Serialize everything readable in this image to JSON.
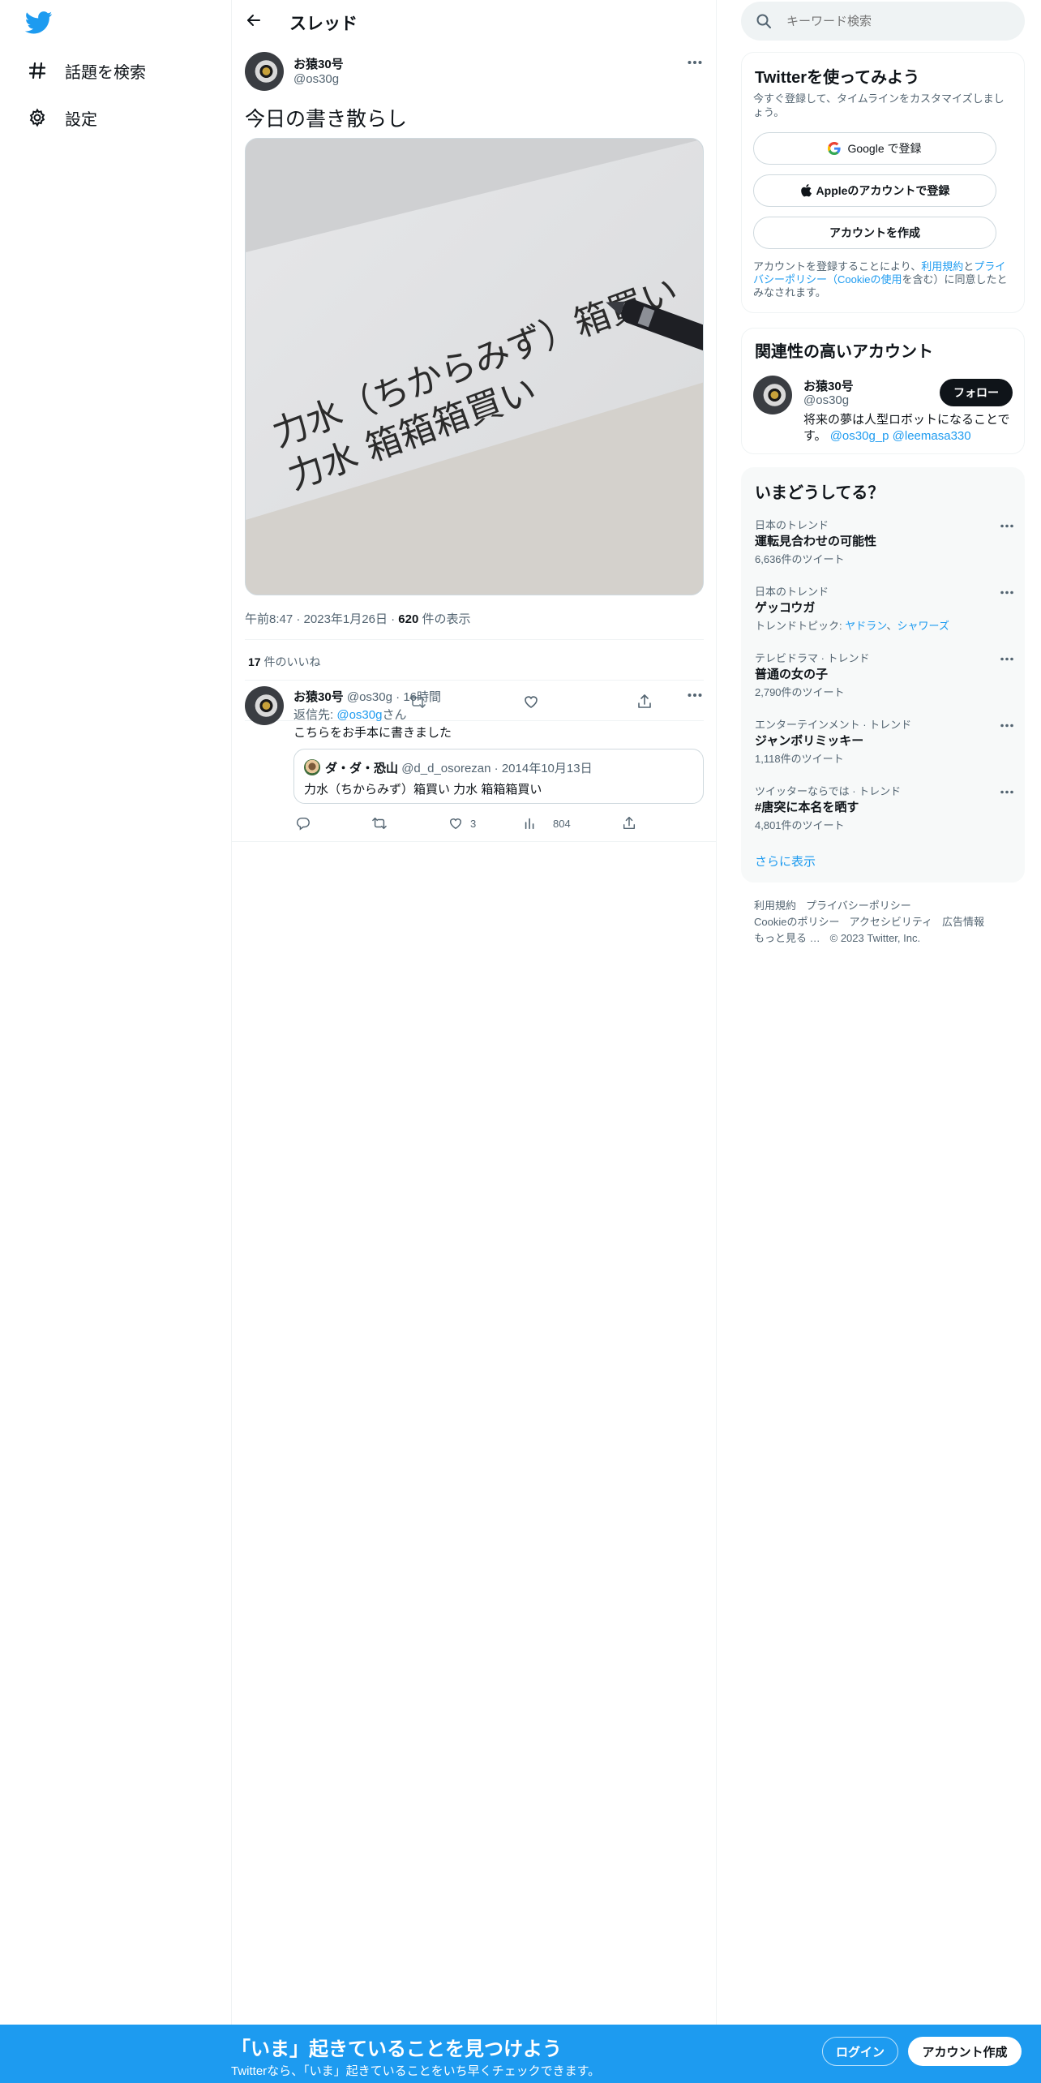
{
  "nav": {
    "items": [
      {
        "label": "話題を検索",
        "icon": "hashtag-icon"
      },
      {
        "label": "設定",
        "icon": "gear-icon"
      }
    ]
  },
  "header": {
    "title": "スレッド"
  },
  "tweet": {
    "name": "お猿30号",
    "handle": "@os30g",
    "text": "今日の書き散らし",
    "photo_lines": [
      "力水（ちからみず）箱買い",
      "力水 箱箱箱買い"
    ],
    "time": "午前8:47",
    "date": "2023年1月26日",
    "views_count": "620",
    "views_label": " 件の表示",
    "likes_count": "17",
    "likes_label": " 件のいいね"
  },
  "reply": {
    "name": "お猿30号",
    "handle": "@os30g",
    "time": "16時間",
    "reply_to_prefix": "返信先: ",
    "reply_to_handle": "@os30g",
    "reply_to_suffix": "さん",
    "text": "こちらをお手本に書きました",
    "quote": {
      "name": "ダ・ダ・恐山",
      "handle": "@d_d_osorezan",
      "date": "2014年10月13日",
      "text": "力水（ちからみず）箱買い 力水 箱箱箱買い"
    },
    "likes": "3",
    "views": "804"
  },
  "sidebar": {
    "search_placeholder": "キーワード検索",
    "signup_card": {
      "title": "Twitterを使ってみよう",
      "subtitle": "今すぐ登録して、タイムラインをカスタマイズしましょう。",
      "google_label": "Google で登録",
      "apple_label": "Appleのアカウントで登録",
      "create_label": "アカウントを作成",
      "terms_1": "アカウントを登録することにより、",
      "terms_link1": "利用規約",
      "terms_2": "と",
      "terms_link2": "プライバシーポリシー（Cookieの使用",
      "terms_3": "を含む）に同意したとみなされます。"
    },
    "relevant": {
      "title": "関連性の高いアカウント",
      "name": "お猿30号",
      "handle": "@os30g",
      "follow_label": "フォロー",
      "bio": "将来の夢は人型ロボットになることです。",
      "bio_link1": "@os30g_p",
      "bio_link2": "@leemasa330"
    },
    "trends": {
      "title": "いまどうしてる？",
      "items": [
        {
          "category": "日本のトレンド",
          "name": "運転見合わせの可能性",
          "count": "6,636件のツイート"
        },
        {
          "category": "日本のトレンド",
          "name": "ゲッコウガ",
          "count": "トレンドトピック: ",
          "topics": [
            "ヤドラン",
            "シャワーズ"
          ]
        },
        {
          "category": "テレビドラマ · トレンド",
          "name": "普通の女の子",
          "count": "2,790件のツイート"
        },
        {
          "category": "エンターテインメント · トレンド",
          "name": "ジャンボリミッキー",
          "count": "1,118件のツイート"
        },
        {
          "category": "ツイッターならでは · トレンド",
          "name": "#唐突に本名を晒す",
          "count": "4,801件のツイート"
        }
      ],
      "show_more": "さらに表示"
    },
    "footer": {
      "line1": [
        "利用規約",
        "プライバシーポリシー"
      ],
      "line2": [
        "Cookieのポリシー",
        "アクセシビリティ",
        "広告情報"
      ],
      "more": "もっと見る …",
      "copyright": "© 2023 Twitter, Inc."
    }
  },
  "bottom_bar": {
    "title": "「いま」起きていることを見つけよう",
    "subtitle": "Twitterなら、「いま」起きていることをいち早くチェックできます。",
    "login_label": "ログイン",
    "signup_label": "アカウント作成"
  },
  "colors": {
    "accent": "#1d9bf0",
    "text": "#0f1419",
    "muted": "#536471",
    "border": "#eff3f4"
  }
}
